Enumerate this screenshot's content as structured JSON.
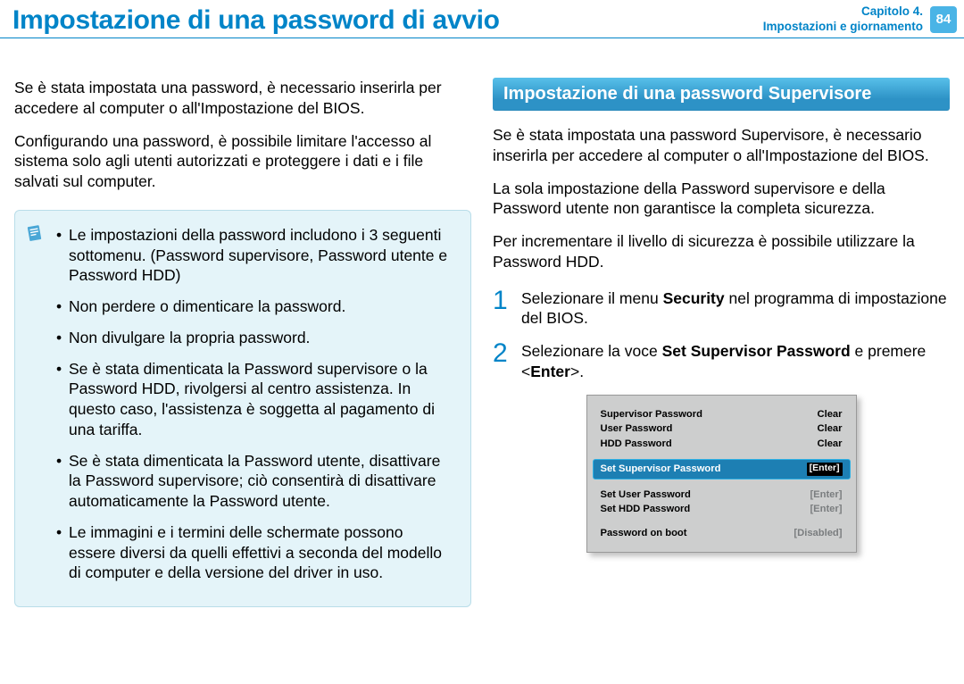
{
  "header": {
    "title": "Impostazione di una password di avvio",
    "chapter_line1": "Capitolo 4.",
    "chapter_line2": "Impostazioni e giornamento",
    "page_number": "84"
  },
  "left": {
    "p1": "Se è stata impostata una password, è necessario inserirla per accedere al computer o all'Impostazione del BIOS.",
    "p2": "Configurando una password, è possibile limitare l'accesso al sistema solo agli utenti autorizzati e proteggere i dati e i file salvati sul computer.",
    "callout": {
      "b1": "Le impostazioni della password includono i 3 seguenti sottomenu. (Password supervisore, Password utente e Password HDD)",
      "b2": "Non perdere o dimenticare la password.",
      "b3": "Non divulgare la propria password.",
      "b4": "Se è stata dimenticata la Password supervisore o la Password HDD, rivolgersi al centro assistenza. In questo caso, l'assistenza è soggetta al pagamento di una tariffa.",
      "b5": "Se è stata dimenticata la Password utente, disattivare la Password supervisore; ciò consentirà di disattivare automaticamente la Password utente.",
      "b6": "Le immagini e i termini delle schermate possono essere diversi da quelli effettivi a seconda del modello di computer e della versione del driver in uso."
    }
  },
  "right": {
    "section_title": "Impostazione di una password Supervisore",
    "p1": "Se è stata impostata una password Supervisore, è necessario inserirla per accedere al computer o all'Impostazione del BIOS.",
    "p2": "La sola impostazione della Password supervisore e della Password utente non garantisce la completa sicurezza.",
    "p3": "Per incrementare il livello di sicurezza è possibile utilizzare la Password HDD.",
    "step1": {
      "num": "1",
      "text_pre": "Selezionare il menu ",
      "bold": "Security",
      "text_post": " nel programma di impostazione del BIOS."
    },
    "step2": {
      "num": "2",
      "text_pre": "Selezionare la voce ",
      "bold": "Set Supervisor Password",
      "text_mid": " e premere <",
      "bold2": "Enter",
      "text_post": ">."
    },
    "bios": {
      "rows_top": [
        {
          "label": "Supervisor Password",
          "val": "Clear"
        },
        {
          "label": "User Password",
          "val": "Clear"
        },
        {
          "label": "HDD Password",
          "val": "Clear"
        }
      ],
      "selected": {
        "label": "Set Supervisor Password",
        "val": "[Enter]"
      },
      "rows_mid": [
        {
          "label": "Set User Password",
          "val": "[Enter]"
        },
        {
          "label": "Set HDD Password",
          "val": "[Enter]"
        }
      ],
      "rows_bot": [
        {
          "label": "Password on boot",
          "val": "[Disabled]"
        }
      ]
    }
  }
}
